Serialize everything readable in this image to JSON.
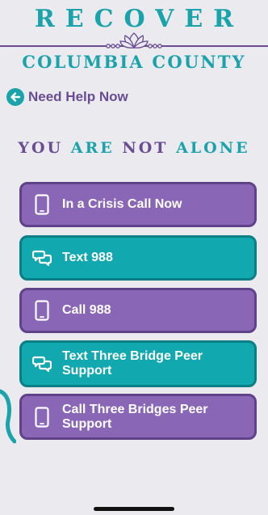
{
  "logo": {
    "line1": "RECOVER",
    "line2": "COLUMBIA COUNTY"
  },
  "back_link": {
    "label": "Need Help Now",
    "icon": "arrow-left-circle-icon"
  },
  "tagline": {
    "part1": "YOU",
    "part2": "ARE",
    "part3": "NOT",
    "part4": "ALONE"
  },
  "buttons": [
    {
      "label": "In a Crisis Call Now",
      "icon": "phone-icon",
      "style": "purple"
    },
    {
      "label": "Text 988",
      "icon": "chat-bubbles-icon",
      "style": "teal"
    },
    {
      "label": "Call 988",
      "icon": "phone-icon",
      "style": "purple"
    },
    {
      "label": "Text Three Bridge Peer Support",
      "icon": "chat-bubbles-icon",
      "style": "teal"
    },
    {
      "label": "Call Three Bridges Peer Support",
      "icon": "phone-icon",
      "style": "purple"
    }
  ],
  "colors": {
    "background": "#eaeaef",
    "teal": "#1aa3ab",
    "purple": "#8a66b6",
    "dark_purple": "#6a4c93"
  }
}
